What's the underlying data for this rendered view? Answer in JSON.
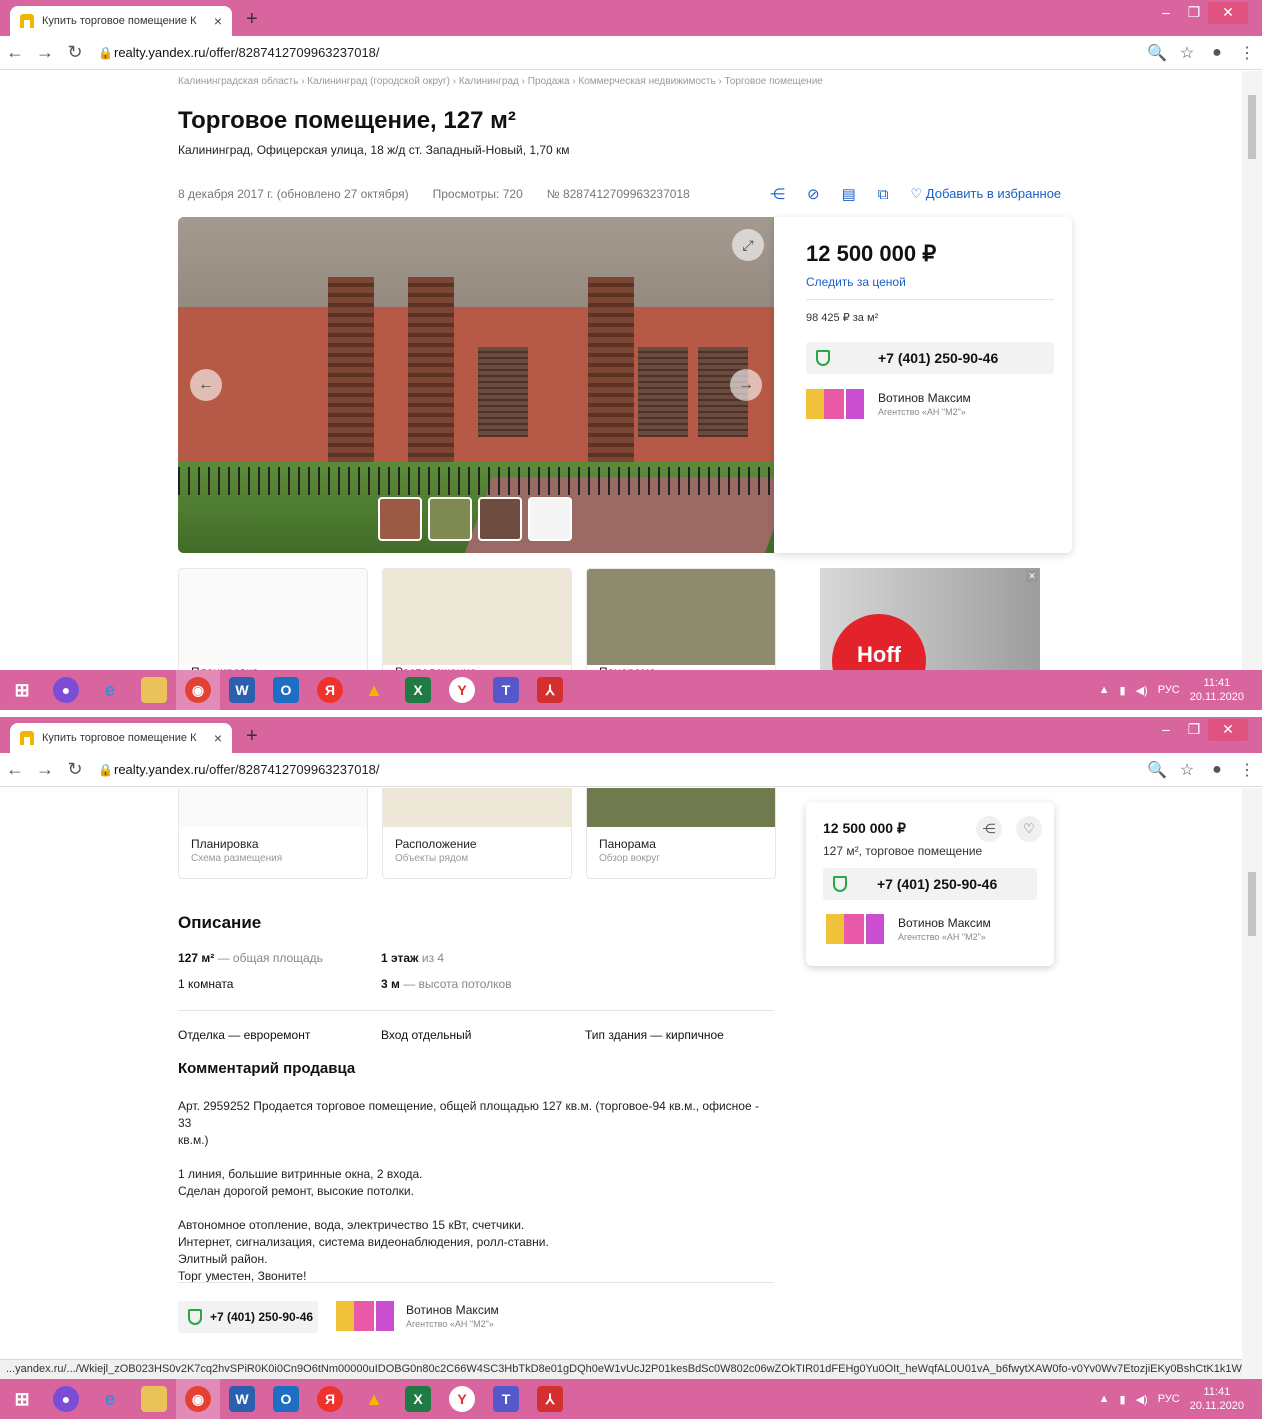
{
  "browser": {
    "tab_title": "Купить торговое помещение К",
    "tab_close": "×",
    "new_tab": "+",
    "url_host": "realty.yandex.ru",
    "url_path": "/offer/8287412709963237018/"
  },
  "breadcrumb": "Калининградская область › Калининград (городской округ) › Калининград › Продажа › Коммерческая недвижимость › Торговое помещение",
  "listing": {
    "title": "Торговое помещение, 127 м²",
    "address": "Калининград, Офицерская улица, 18   ж/д ст. Западный-Новый, 1,70 км",
    "date": "8 декабря 2017 г. (обновлено 27 октября)",
    "views": "Просмотры: 720",
    "number": "№ 8287412709963237018",
    "add_favorite": "Добавить в избранное"
  },
  "price_card": {
    "price": "12 500 000 ₽",
    "follow_price": "Следить за ценой",
    "price_per_m2": "98 425 ₽ за м²",
    "phone": "+7 (401) 250-90-46",
    "agent_name": "Вотинов Максим",
    "agent_org": "Агентство «АН \"М2\"»"
  },
  "mini_cards": [
    {
      "title": "Планировка",
      "subtitle": "Схема размещения"
    },
    {
      "title": "Расположение",
      "subtitle": "Объекты рядом"
    },
    {
      "title": "Панорама",
      "subtitle": "Обзор вокруг"
    }
  ],
  "ad": {
    "brand": "Hoff"
  },
  "sticky_card": {
    "price": "12 500 000 ₽",
    "subtitle": "127 м², торговое помещение",
    "phone": "+7 (401) 250-90-46",
    "agent_name": "Вотинов Максим",
    "agent_org": "Агентство «АН \"М2\"»"
  },
  "description": {
    "title": "Описание",
    "area_value": "127 м²",
    "area_label": " — общая площадь",
    "floor_value": "1 этаж",
    "floor_label": " из 4",
    "rooms": "1 комната",
    "ceiling_value": "3 м",
    "ceiling_label": " — высота потолков",
    "finish": "Отделка — евроремонт",
    "entrance": "Вход отдельный",
    "building": "Тип здания — кирпичное"
  },
  "seller_comment": {
    "title": "Комментарий продавца",
    "line1": "Арт. 2959252 Продается торговое помещение, общей площадью 127 кв.м. (торговое-94 кв.м., офисное - 33",
    "line2": "кв.м.)",
    "line3": "1 линия, большие витринные окна, 2 входа.",
    "line4": "Сделан дорогой ремонт, высокие потолки.",
    "line5": "Автономное отопление, вода, электричество 15 кВт, счетчики.",
    "line6": "Интернет, сигнализация, система видеонаблюдения, ролл-ставни.",
    "line7": "Элитный район.",
    "line8": "Торг уместен, Звоните!"
  },
  "footer_contact": {
    "phone": "+7 (401) 250-90-46",
    "agent_name": "Вотинов Максим",
    "agent_org": "Агентство «АН \"М2\"»"
  },
  "status_url": "...yandex.ru/.../Wkiejl_zOB023HS0v2K7cq2hvSPiR0K0i0Cn9O6tNm00000uIDOBG0n80c2C66W4SC3HbTkD8e01gDQh0eW1vUcJ2P01kesBdSc0W802c06wZOkTIR01dFEHg0Yu0OIt_heWqfAL0U01vA_b6fwytXAW0fo-v0Yv0Wv7EtozjiEKy0BshCtK1k1Wk0J_0...",
  "taskbar": {
    "lang": "РУС",
    "time": "11:41",
    "date": "20.11.2020"
  },
  "colors": {
    "accent": "#d9659f",
    "link": "#1b5fc7",
    "shield": "#27a844",
    "ad_red": "#e3232b"
  }
}
